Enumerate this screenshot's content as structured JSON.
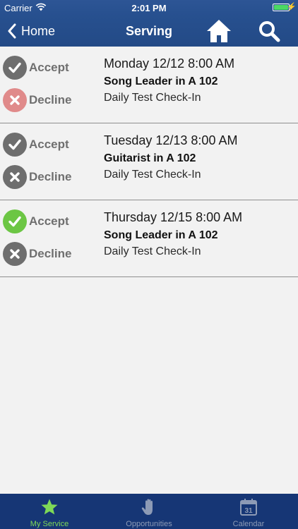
{
  "status_bar": {
    "carrier": "Carrier",
    "time": "2:01 PM",
    "battery_level": 1.0
  },
  "nav": {
    "back_label": "Home",
    "title": "Serving"
  },
  "colors": {
    "nav_blue": "#27508f",
    "tab_blue": "#163675",
    "accept_green": "#6cc644",
    "decline_red": "#e08a8a",
    "neutral_gray": "#6e6e6e",
    "active_tab_green": "#7ed957"
  },
  "assignments": [
    {
      "date": "Monday 12/12 8:00 AM",
      "role": "Song Leader in A 102",
      "event": "Daily Test Check-In",
      "accept_label": "Accept",
      "decline_label": "Decline",
      "response": "declined"
    },
    {
      "date": "Tuesday 12/13 8:00 AM",
      "role": "Guitarist in A 102",
      "event": "Daily Test Check-In",
      "accept_label": "Accept",
      "decline_label": "Decline",
      "response": "none"
    },
    {
      "date": "Thursday 12/15 8:00 AM",
      "role": "Song Leader in A 102",
      "event": "Daily Test Check-In",
      "accept_label": "Accept",
      "decline_label": "Decline",
      "response": "accepted"
    }
  ],
  "tabs": [
    {
      "label": "My Service",
      "icon": "star-icon",
      "active": true
    },
    {
      "label": "Opportunities",
      "icon": "hand-icon",
      "active": false
    },
    {
      "label": "Calendar",
      "icon": "calendar-icon",
      "active": false,
      "calendar_day": "31"
    }
  ]
}
